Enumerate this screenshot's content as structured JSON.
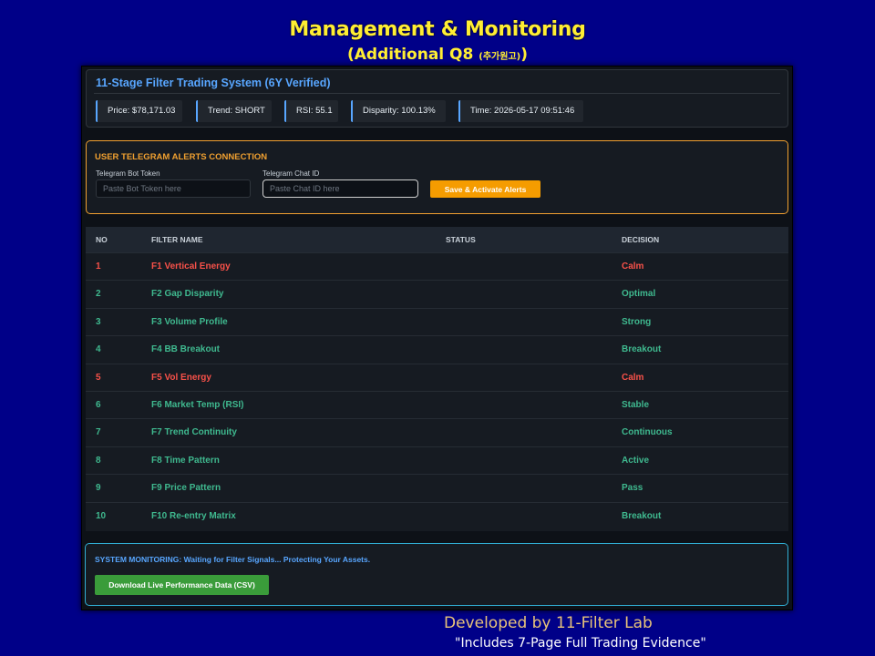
{
  "slide": {
    "title": "Management & Monitoring",
    "subtitle_main": "(Additional Q8",
    "subtitle_small": "(추가원고)",
    "subtitle_end": ")",
    "developer": "Developed by 11-Filter Lab",
    "evidence": "\"Includes 7-Page Full Trading Evidence\""
  },
  "header": {
    "title": "11-Stage Filter Trading System (6Y Verified)",
    "pills": {
      "price": "Price: $78,171.03",
      "trend": "Trend: SHORT",
      "rsi": "RSI: 55.1",
      "disparity": "Disparity: 100.13%",
      "time": "Time: 2026-05-17 09:51:46"
    }
  },
  "alerts": {
    "title": "USER TELEGRAM ALERTS CONNECTION",
    "token_label": "Telegram Bot Token",
    "token_placeholder": "Paste Bot Token here",
    "chat_label": "Telegram Chat ID",
    "chat_placeholder": "Paste Chat ID here",
    "save_label": "Save & Activate Alerts",
    "accent_color": "#f0a030"
  },
  "table": {
    "headers": {
      "no": "NO",
      "name": "FILTER NAME",
      "status": "STATUS",
      "decision": "DECISION"
    },
    "rows": [
      {
        "no": "1",
        "name": "F1 Vertical Energy",
        "status": "",
        "decision": "Calm",
        "color": "red"
      },
      {
        "no": "2",
        "name": "F2 Gap Disparity",
        "status": "",
        "decision": "Optimal",
        "color": "green"
      },
      {
        "no": "3",
        "name": "F3 Volume Profile",
        "status": "",
        "decision": "Strong",
        "color": "green"
      },
      {
        "no": "4",
        "name": "F4 BB Breakout",
        "status": "",
        "decision": "Breakout",
        "color": "green"
      },
      {
        "no": "5",
        "name": "F5 Vol Energy",
        "status": "",
        "decision": "Calm",
        "color": "red"
      },
      {
        "no": "6",
        "name": "F6 Market Temp (RSI)",
        "status": "",
        "decision": "Stable",
        "color": "green"
      },
      {
        "no": "7",
        "name": "F7 Trend Continuity",
        "status": "",
        "decision": "Continuous",
        "color": "green"
      },
      {
        "no": "8",
        "name": "F8 Time Pattern",
        "status": "",
        "decision": "Active",
        "color": "green"
      },
      {
        "no": "9",
        "name": "F9 Price Pattern",
        "status": "",
        "decision": "Pass",
        "color": "green"
      },
      {
        "no": "10",
        "name": "F10 Re-entry Matrix",
        "status": "",
        "decision": "Breakout",
        "color": "green"
      }
    ]
  },
  "monitoring": {
    "message": "SYSTEM MONITORING: Waiting for Filter Signals... Protecting Your Assets.",
    "csv_label": "Download Live Performance Data (CSV)",
    "accent_color": "#31b0d5"
  }
}
